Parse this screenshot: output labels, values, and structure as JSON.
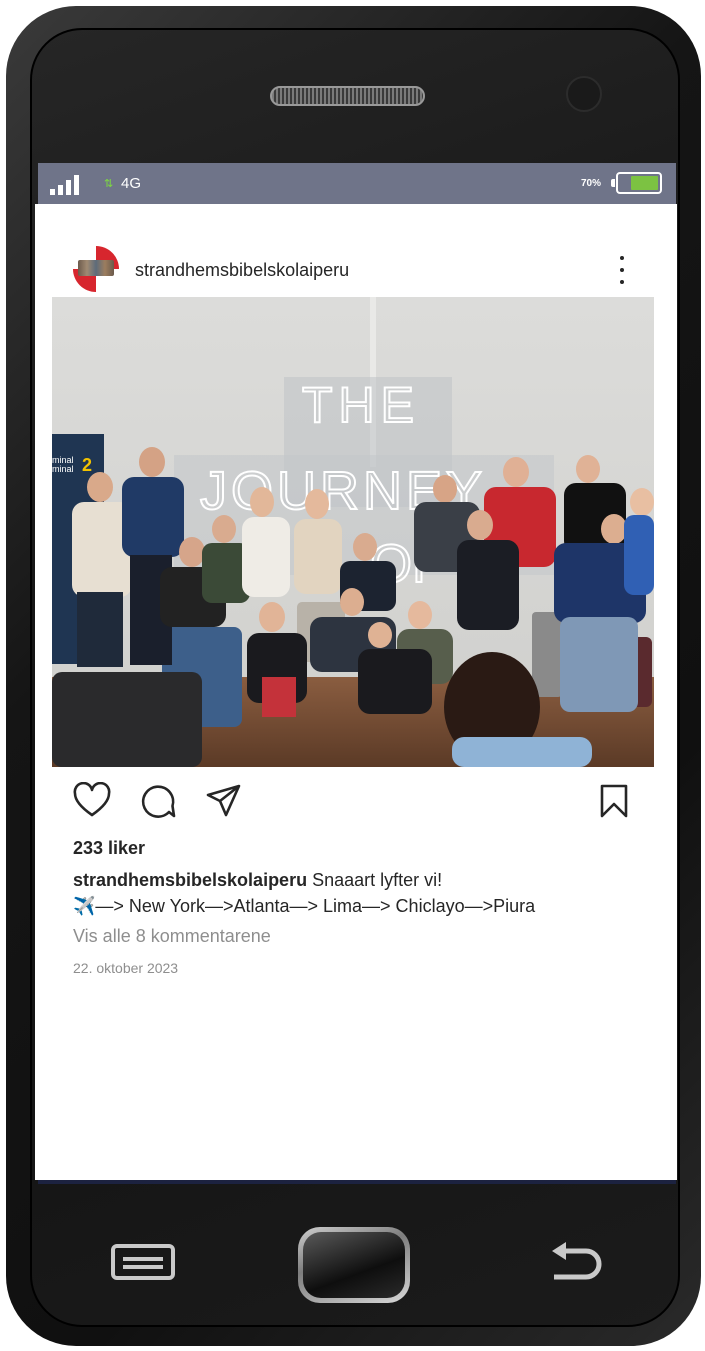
{
  "status_bar": {
    "network": "4G",
    "battery_percent": "70%",
    "battery_level": 0.7,
    "signal_bars": 4,
    "colors": {
      "background": "#6f7489",
      "battery_fill": "#7cc242",
      "data_arrows": "#7ddc3f"
    }
  },
  "post": {
    "username": "strandhemsbibelskolaiperu",
    "likes": "233 liker",
    "caption_text": "Snaaart lyfter vi!",
    "caption_route": "✈️—> New York—>Atlanta—> Lima—> Chiclayo—>Piura",
    "view_comments": "Vis alle 8 kommentarene",
    "date": "22. oktober 2023",
    "image_sign_text": [
      "THE",
      "JOURNEY",
      "OF"
    ],
    "image_terminal_sign": [
      "minal",
      "minal",
      "2"
    ]
  },
  "icons": {
    "header": [
      "avatar",
      "more-vertical-icon"
    ],
    "actions": [
      "heart-icon",
      "comment-icon",
      "share-icon",
      "bookmark-icon"
    ],
    "device": [
      "menu-icon",
      "home-button",
      "back-arrow-icon"
    ]
  }
}
